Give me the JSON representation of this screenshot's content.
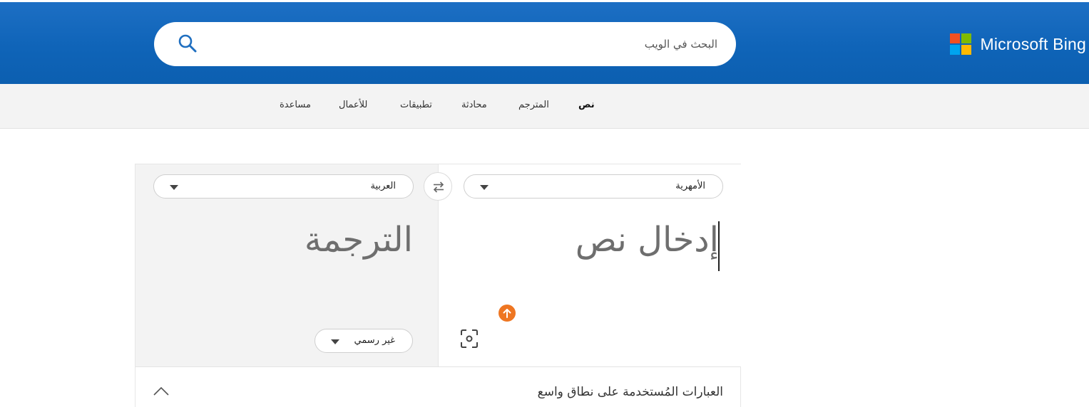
{
  "header": {
    "brand": "Microsoft Bing",
    "logo_colors": [
      "#f25022",
      "#7fba00",
      "#00a4ef",
      "#ffb900"
    ],
    "search": {
      "placeholder": "البحث في الويب",
      "value": "",
      "icon": "search-icon"
    }
  },
  "nav": {
    "items": [
      {
        "label": "نص",
        "active": true
      },
      {
        "label": "المترجم",
        "active": false
      },
      {
        "label": "محادثة",
        "active": false
      },
      {
        "label": "تطبيقات",
        "active": false
      },
      {
        "label": "للأعمال",
        "active": false
      },
      {
        "label": "مساعدة",
        "active": false
      }
    ]
  },
  "translator": {
    "source_language": "الأمهرية",
    "target_language": "العربية",
    "input_placeholder": "إدخال نص",
    "output_placeholder": "الترجمة",
    "tone": "غير رسمي",
    "swap_icon": "swap-arrows-icon",
    "upload_icon": "upload-arrow-icon",
    "camera_icon": "camera-scan-icon"
  },
  "phrases": {
    "title": "العبارات المُستخدمة على نطاق واسع"
  },
  "colors": {
    "header_blue": "#0f64b8",
    "badge_orange": "#ee7622"
  }
}
